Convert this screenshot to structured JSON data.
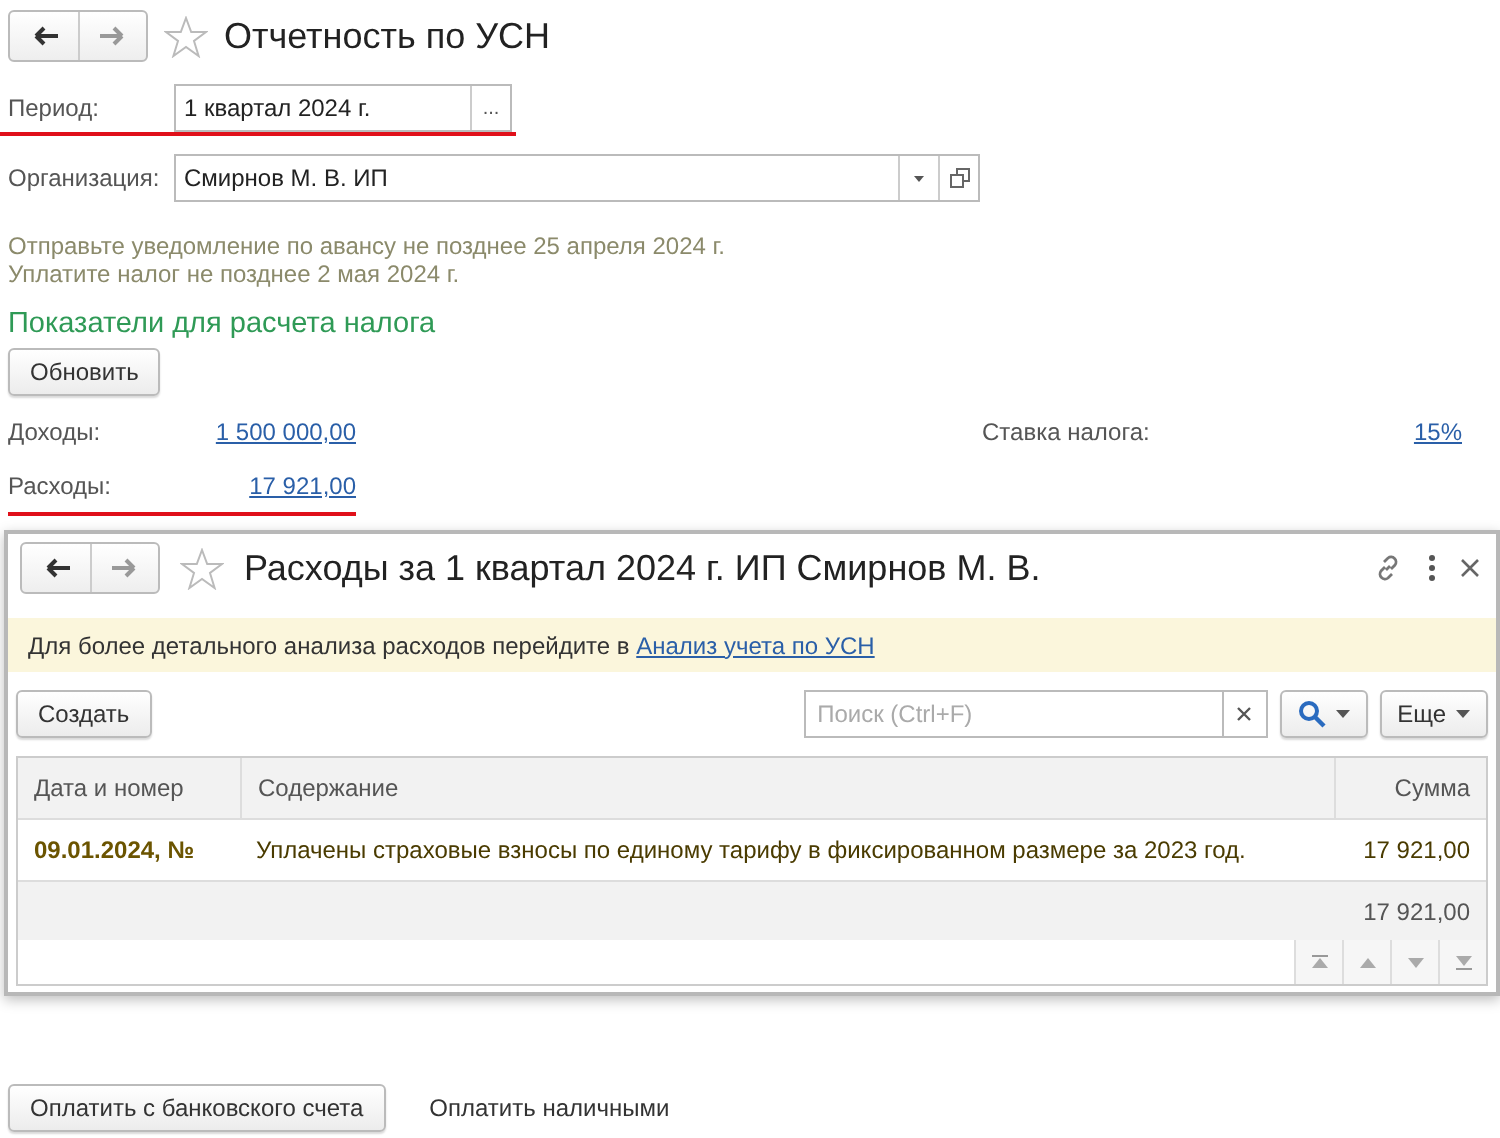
{
  "window": {
    "title": "Отчетность по УСН"
  },
  "fields": [
    {
      "kind": "period",
      "label": "Период:",
      "value": "1 квартал 2024 г.",
      "button": "...",
      "underlined": true
    },
    {
      "kind": "organization",
      "label": "Организация:",
      "value": "Смирнов М. В. ИП",
      "underlined": false
    }
  ],
  "notices": [
    "Отправьте уведомление по авансу не позднее 25 апреля 2024 г.",
    "Уплатите налог не позднее 2 мая 2024 г."
  ],
  "section_title": "Показатели для расчета налога",
  "refresh_button": "Обновить",
  "indicators": [
    {
      "kind": "income",
      "label": "Доходы:",
      "value": "1 500 000,00",
      "underlined": false
    },
    {
      "kind": "rate",
      "label": "Ставка налога:",
      "value": "15%",
      "underlined": false
    },
    {
      "kind": "expense",
      "label": "Расходы:",
      "value": "17 921,00",
      "underlined": true
    }
  ],
  "popup": {
    "title": "Расходы за 1 квартал 2024 г. ИП Смирнов М. В.",
    "info": "Для более детального анализа расходов перейдите в",
    "info_link": "Анализ учета по УСН",
    "create_button": "Создать",
    "search": {
      "placeholder": "Поиск (Ctrl+F)"
    },
    "more_button": "Еще",
    "table": {
      "columns": [
        "Дата и номер",
        "Содержание",
        "Сумма"
      ],
      "rows": [
        {
          "date": "09.01.2024, №",
          "content": "Уплачены страховые взносы по единому тарифу в фиксированном размере за 2023 год.",
          "sum": "17 921,00"
        }
      ],
      "total": "17 921,00"
    }
  },
  "bottom_actions": [
    {
      "kind": "button",
      "label": "Оплатить с банковского счета"
    },
    {
      "kind": "link",
      "label": "Оплатить наличными"
    }
  ]
}
